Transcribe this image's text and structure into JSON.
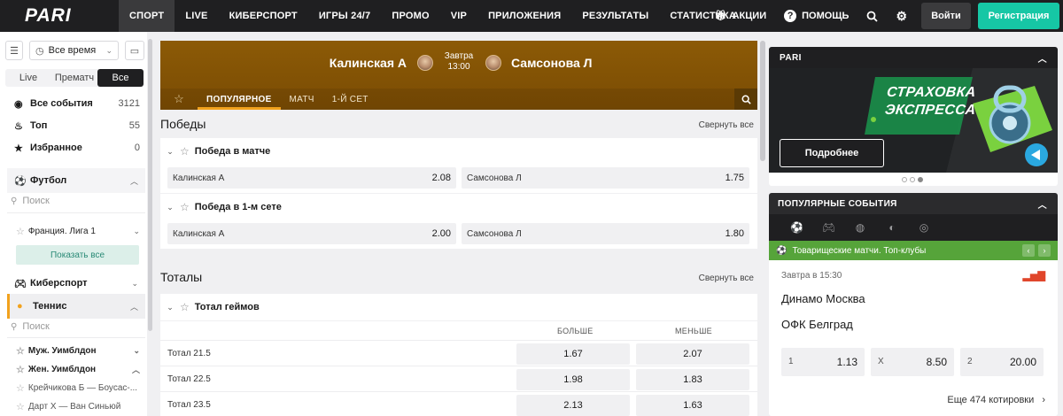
{
  "nav": {
    "logo": "PARI",
    "items": [
      "СПОРТ",
      "LIVE",
      "КИБЕРСПОРТ",
      "ИГРЫ 24/7",
      "ПРОМО",
      "VIP",
      "ПРИЛОЖЕНИЯ",
      "РЕЗУЛЬТАТЫ",
      "СТАТИСТИКА"
    ],
    "active_index": 0,
    "promo_label": "АКЦИИ",
    "help_label": "ПОМОЩЬ",
    "login": "Войти",
    "register": "Регистрация"
  },
  "sidebar": {
    "time_filter": "Все время",
    "tabs": [
      "Live",
      "Прематч",
      "Все"
    ],
    "active_tab_index": 2,
    "categories": [
      {
        "label": "Все события",
        "count": "3121",
        "icon": "compass-icon"
      },
      {
        "label": "Топ",
        "count": "55",
        "icon": "fire-icon"
      },
      {
        "label": "Избранное",
        "count": "0",
        "icon": "star-icon"
      }
    ],
    "football": {
      "label": "Футбол",
      "search_placeholder": "Поиск",
      "league_partial": "",
      "league": "Франция. Лига 1",
      "show_all": "Показать все"
    },
    "esports": {
      "label": "Киберспорт"
    },
    "tennis": {
      "label": "Теннис",
      "search_placeholder": "Поиск",
      "leagues": [
        "Муж. Уимблдон",
        "Жен. Уимблдон"
      ],
      "matches": [
        "Крейчикова Б — Боусас-...",
        "Дарт Х — Ван Синьюй"
      ]
    }
  },
  "event": {
    "team1": "Калинская А",
    "team2": "Самсонова Л",
    "day": "Завтра",
    "time": "13:00",
    "tabs": [
      "ПОПУЛЯРНОЕ",
      "МАТЧ",
      "1-Й СЕТ"
    ],
    "active_tab_index": 0
  },
  "wins": {
    "title": "Победы",
    "collapse": "Свернуть все",
    "markets": [
      {
        "title": "Победа в матче",
        "odds": [
          {
            "label": "Калинская А",
            "value": "2.08"
          },
          {
            "label": "Самсонова Л",
            "value": "1.75"
          }
        ]
      },
      {
        "title": "Победа в 1-м сете",
        "odds": [
          {
            "label": "Калинская А",
            "value": "2.00"
          },
          {
            "label": "Самсонова Л",
            "value": "1.80"
          }
        ]
      }
    ]
  },
  "totals": {
    "title": "Тоталы",
    "collapse": "Свернуть все",
    "market_title": "Тотал геймов",
    "col_over": "БОЛЬШЕ",
    "col_under": "МЕНЬШЕ",
    "rows": [
      {
        "label": "Тотал 21.5",
        "over": "1.67",
        "under": "2.07"
      },
      {
        "label": "Тотал 22.5",
        "over": "1.98",
        "under": "1.83"
      },
      {
        "label": "Тотал 23.5",
        "over": "2.13",
        "under": "1.63"
      }
    ]
  },
  "promo": {
    "header": "PARI",
    "banner_line1": "СТРАХОВКА",
    "banner_line2": "ЭКСПРЕССА",
    "button": "Подробнее",
    "dots_active_index": 2
  },
  "popular": {
    "header": "ПОПУЛЯРНЫЕ СОБЫТИЯ",
    "league": "Товарищеские матчи. Топ-клубы",
    "date": "Завтра в 15:30",
    "team1": "Динамо Москва",
    "team2": "ОФК Белград",
    "odds": [
      {
        "label": "1",
        "value": "1.13"
      },
      {
        "label": "X",
        "value": "8.50"
      },
      {
        "label": "2",
        "value": "20.00"
      }
    ],
    "more": "Еще 474 котировки"
  }
}
